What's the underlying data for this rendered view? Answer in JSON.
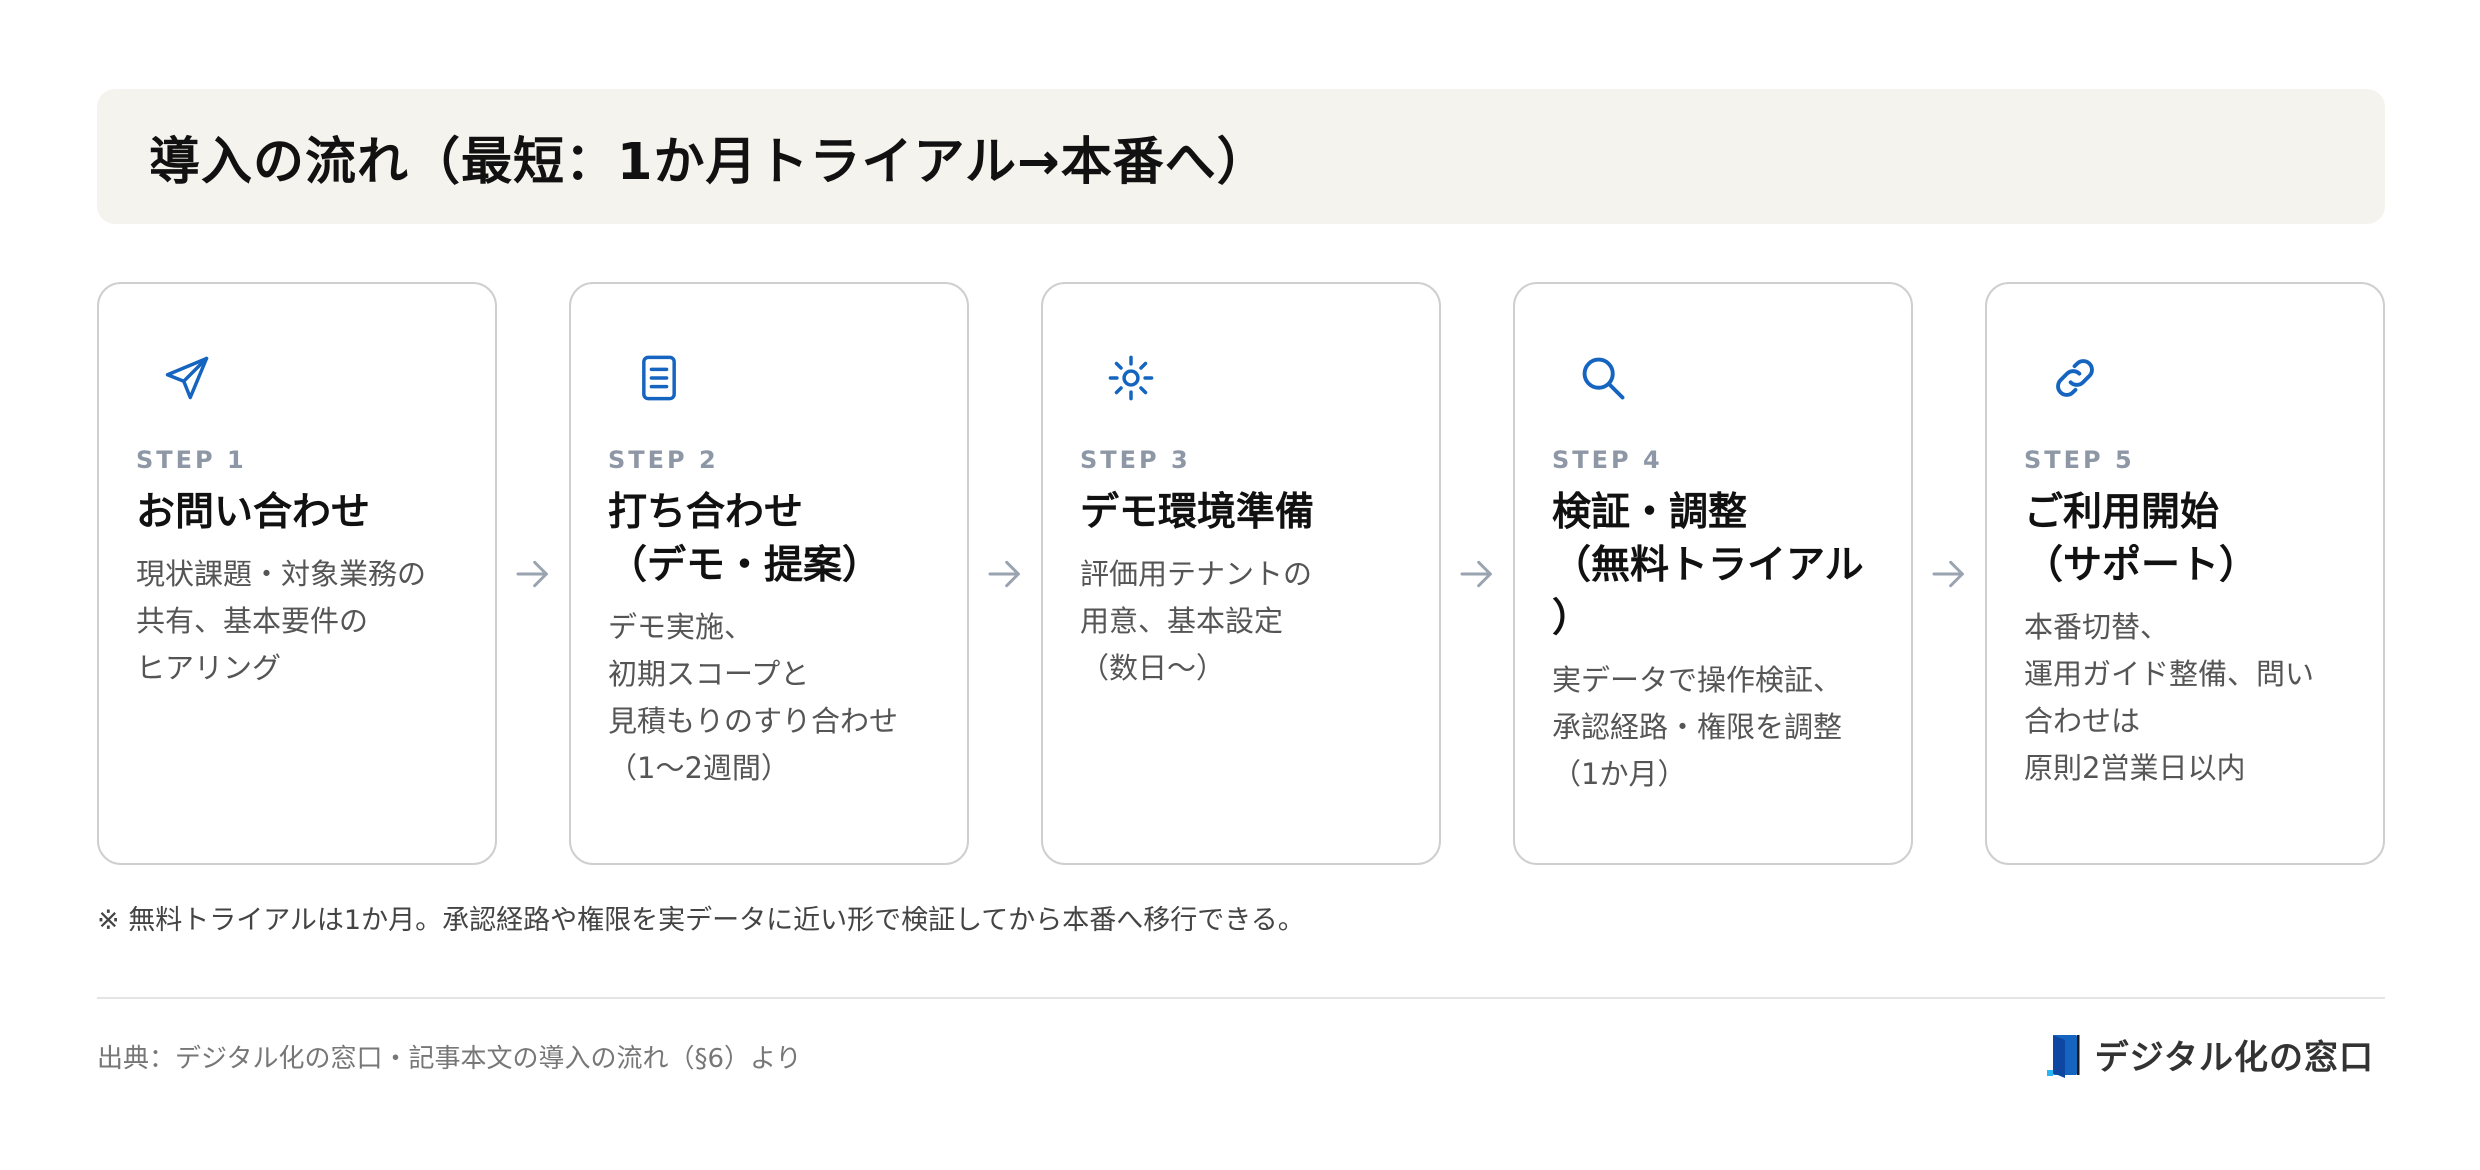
{
  "title": "導入の流れ（最短：1か月トライアル→本番へ）",
  "steps": [
    {
      "icon": "send-icon",
      "label": "STEP 1",
      "title": "お問い合わせ",
      "description": "現状課題・対象業務の\n共有、基本要件の\nヒアリング"
    },
    {
      "icon": "document-icon",
      "label": "STEP 2",
      "title": "打ち合わせ\n（デモ・提案）",
      "description": "デモ実施、\n初期スコープと\n見積もりのすり合わせ\n（1〜2週間）"
    },
    {
      "icon": "gear-icon",
      "label": "STEP 3",
      "title": "デモ環境準備",
      "description": "評価用テナントの\n用意、基本設定\n（数日〜）"
    },
    {
      "icon": "search-icon",
      "label": "STEP 4",
      "title": "検証・調整\n（無料トライアル\n）",
      "description": "実データで操作検証、\n承認経路・権限を調整\n（1か月）"
    },
    {
      "icon": "link-icon",
      "label": "STEP 5",
      "title": "ご利用開始\n（サポート）",
      "description": "本番切替、\n運用ガイド整備、問い\n合わせは\n原則2営業日以内"
    }
  ],
  "note": "※ 無料トライアルは1か月。承認経路や権限を実データに近い形で検証してから本番へ移行できる。",
  "source": "出典：デジタル化の窓口・記事本文の導入の流れ（§6）より",
  "brand": {
    "name": "デジタル化の窓口",
    "logo_icon": "window-logo-icon"
  },
  "colors": {
    "accent": "#1565c0",
    "title_band": "#f5f3ee",
    "step_label": "#8e97a6",
    "arrow": "#9aa3b0"
  }
}
